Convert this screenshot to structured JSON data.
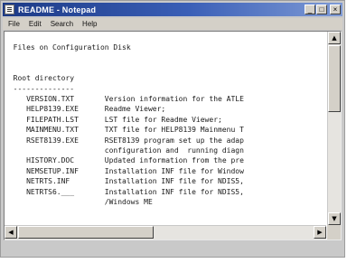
{
  "window": {
    "title": "README - Notepad",
    "buttons": {
      "minimize": "_",
      "maximize": "□",
      "close": "×"
    }
  },
  "menu": [
    "File",
    "Edit",
    "Search",
    "Help"
  ],
  "content": {
    "lines": [
      "  Files on Configuration Disk",
      "",
      "",
      "  Root directory",
      "  --------------",
      "     VERSION.TXT       Version information for the ATLE",
      "     HELP8139.EXE      Readme Viewer;",
      "     FILEPATH.LST      LST file for Readme Viewer;",
      "     MAINMENU.TXT      TXT file for HELP8139 Mainmenu T",
      "     RSET8139.EXE      RSET8139 program set up the adap",
      "                       configuration and  running diagn",
      "     HISTORY.DOC       Updated information from the pre",
      "     NEMSETUP.INF      Installation INF file for Window",
      "     NETRTS.INF        Installation INF file for NDIS5,",
      "     NETRTS6.___       Installation INF file for NDIS5,",
      "                       /Windows ME"
    ]
  },
  "scrollbars": {
    "up_arrow": "▲",
    "down_arrow": "▼",
    "left_arrow": "◀",
    "right_arrow": "▶"
  }
}
